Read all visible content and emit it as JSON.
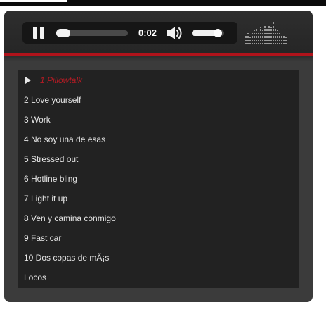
{
  "player": {
    "status": "playing",
    "time": "0:02",
    "progress_fraction": 0.18,
    "volume_fraction": 0.8
  },
  "icons": {
    "play_pause": "pause-icon",
    "volume": "speaker-volume-icon",
    "now_playing_marker": "play-triangle-icon",
    "visualizer": "equalizer-icon"
  },
  "colors": {
    "accent": "#b0131b",
    "active_track": "#b51b24",
    "panel": "#3b3b3b",
    "playlist_bg": "#222222",
    "text": "#e6e6e6"
  },
  "playlist": {
    "active_index": 0,
    "tracks": [
      "1 Pillowtalk",
      "2 Love yourself",
      "3 Work",
      "4 No soy una de esas",
      "5 Stressed out",
      "6 Hotline bling",
      "7 Light it up",
      "8 Ven y camina conmigo",
      "9 Fast car",
      "10 Dos copas de mÃ¡s",
      "Locos"
    ]
  }
}
